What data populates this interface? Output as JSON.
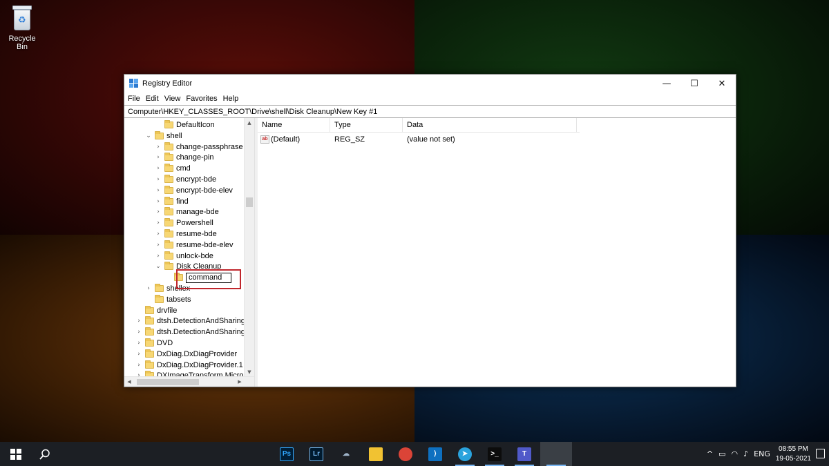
{
  "desktop": {
    "recycle_bin_label": "Recycle Bin"
  },
  "window": {
    "title": "Registry Editor",
    "controls": {
      "minimize": "—",
      "maximize": "☐",
      "close": "✕"
    },
    "menu": [
      "File",
      "Edit",
      "View",
      "Favorites",
      "Help"
    ],
    "address": "Computer\\HKEY_CLASSES_ROOT\\Drive\\shell\\Disk Cleanup\\New Key #1"
  },
  "tree": {
    "items": [
      {
        "label": "DefaultIcon",
        "chevron": ""
      },
      {
        "label": "shell",
        "chevron": "⌄"
      },
      {
        "label": "change-passphrase",
        "chevron": "›"
      },
      {
        "label": "change-pin",
        "chevron": "›"
      },
      {
        "label": "cmd",
        "chevron": "›"
      },
      {
        "label": "encrypt-bde",
        "chevron": "›"
      },
      {
        "label": "encrypt-bde-elev",
        "chevron": "›"
      },
      {
        "label": "find",
        "chevron": "›"
      },
      {
        "label": "manage-bde",
        "chevron": "›"
      },
      {
        "label": "Powershell",
        "chevron": "›"
      },
      {
        "label": "resume-bde",
        "chevron": "›"
      },
      {
        "label": "resume-bde-elev",
        "chevron": "›"
      },
      {
        "label": "unlock-bde",
        "chevron": "›"
      },
      {
        "label": "Disk Cleanup",
        "chevron": "⌄"
      },
      {
        "label": "command",
        "chevron": ""
      },
      {
        "label": "shellex",
        "chevron": "›"
      },
      {
        "label": "tabsets",
        "chevron": ""
      },
      {
        "label": "drvfile",
        "chevron": ""
      },
      {
        "label": "dtsh.DetectionAndSharing",
        "chevron": "›"
      },
      {
        "label": "dtsh.DetectionAndSharing",
        "chevron": "›"
      },
      {
        "label": "DVD",
        "chevron": "›"
      },
      {
        "label": "DxDiag.DxDiagProvider",
        "chevron": "›"
      },
      {
        "label": "DxDiag.DxDiagProvider.1",
        "chevron": "›"
      },
      {
        "label": "DXImageTransform.Micro",
        "chevron": "›"
      }
    ],
    "rename_value": "command"
  },
  "list": {
    "columns": [
      "Name",
      "Type",
      "Data"
    ],
    "rows": [
      {
        "name": "(Default)",
        "type": "REG_SZ",
        "data": "(value not set)"
      }
    ]
  },
  "taskbar": {
    "apps": [
      {
        "name": "photoshop-icon",
        "text": "Ps",
        "color": "#001e36",
        "fg": "#31a8ff"
      },
      {
        "name": "lightroom-icon",
        "text": "Lr",
        "color": "#001a2e",
        "fg": "#74b8f0"
      },
      {
        "name": "cloud-app-icon",
        "text": "☁",
        "color": "transparent",
        "fg": "#9fb4c9"
      },
      {
        "name": "file-explorer-icon",
        "text": "",
        "color": "#f1c232",
        "fg": "#fff"
      },
      {
        "name": "chrome-icon",
        "text": "",
        "color": "#db4437",
        "fg": "#fff"
      },
      {
        "name": "vscode-icon",
        "text": "⟩",
        "color": "#0e70c0",
        "fg": "#fff"
      },
      {
        "name": "telegram-icon",
        "text": "➤",
        "color": "#2aa3dd",
        "fg": "#fff"
      },
      {
        "name": "terminal-icon",
        "text": ">_",
        "color": "#0c0c0c",
        "fg": "#fff"
      },
      {
        "name": "teams-icon",
        "text": "T",
        "color": "#5059c9",
        "fg": "#fff"
      },
      {
        "name": "registry-editor-icon",
        "text": "",
        "color": "transparent",
        "fg": "#4aa3f5"
      }
    ],
    "tray": {
      "chevron": "^",
      "language": "ENG",
      "time": "08:55 PM",
      "date": "19-05-2021"
    }
  }
}
